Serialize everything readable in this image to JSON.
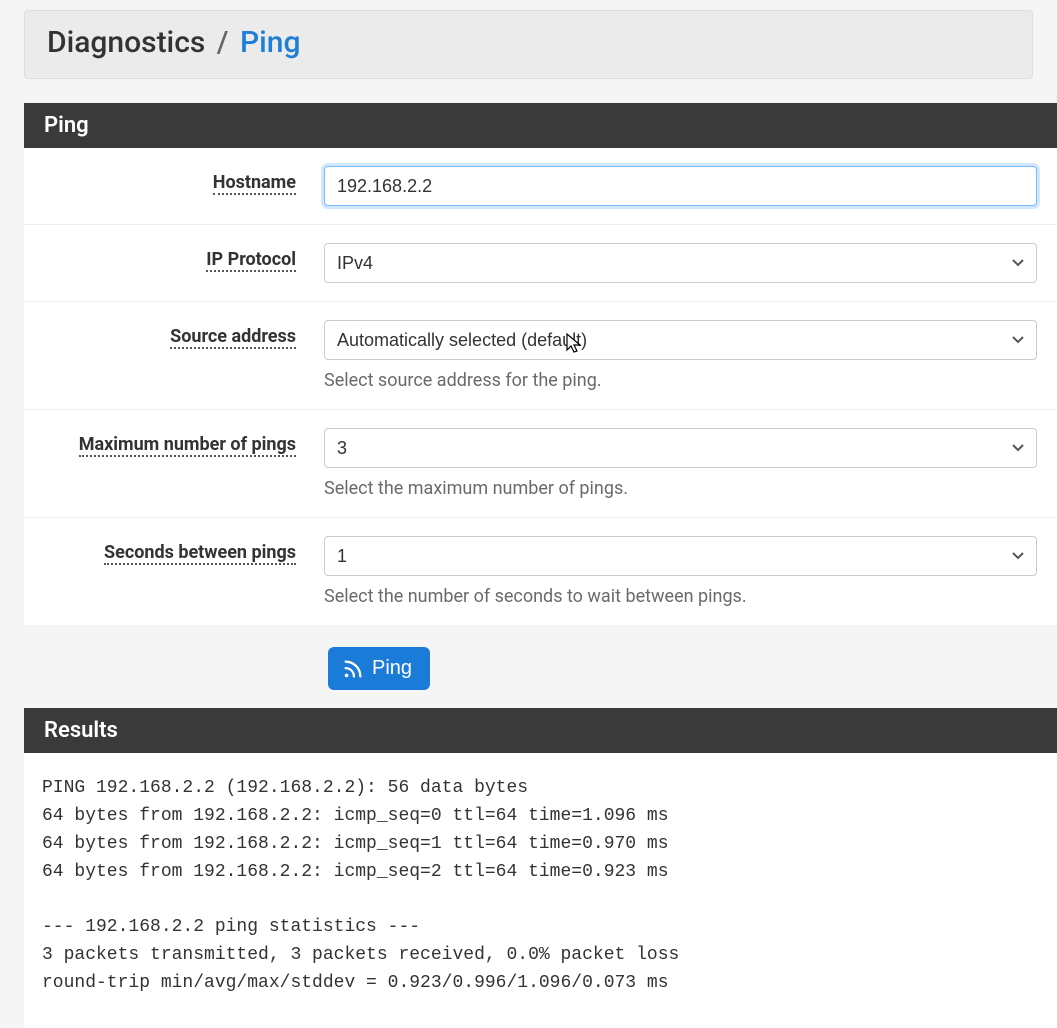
{
  "breadcrumb": {
    "parent": "Diagnostics",
    "separator": "/",
    "current": "Ping"
  },
  "panel": {
    "title": "Ping",
    "fields": {
      "hostname": {
        "label": "Hostname",
        "value": "192.168.2.2"
      },
      "ip_protocol": {
        "label": "IP Protocol",
        "value": "IPv4"
      },
      "source_address": {
        "label": "Source address",
        "value": "Automatically selected (default)",
        "help": "Select source address for the ping."
      },
      "max_pings": {
        "label": "Maximum number of pings",
        "value": "3",
        "help": "Select the maximum number of pings."
      },
      "seconds_between": {
        "label": "Seconds between pings",
        "value": "1",
        "help": "Select the number of seconds to wait between pings."
      }
    },
    "submit_label": "Ping"
  },
  "results": {
    "title": "Results",
    "output": "PING 192.168.2.2 (192.168.2.2): 56 data bytes\n64 bytes from 192.168.2.2: icmp_seq=0 ttl=64 time=1.096 ms\n64 bytes from 192.168.2.2: icmp_seq=1 ttl=64 time=0.970 ms\n64 bytes from 192.168.2.2: icmp_seq=2 ttl=64 time=0.923 ms\n\n--- 192.168.2.2 ping statistics ---\n3 packets transmitted, 3 packets received, 0.0% packet loss\nround-trip min/avg/max/stddev = 0.923/0.996/1.096/0.073 ms"
  }
}
